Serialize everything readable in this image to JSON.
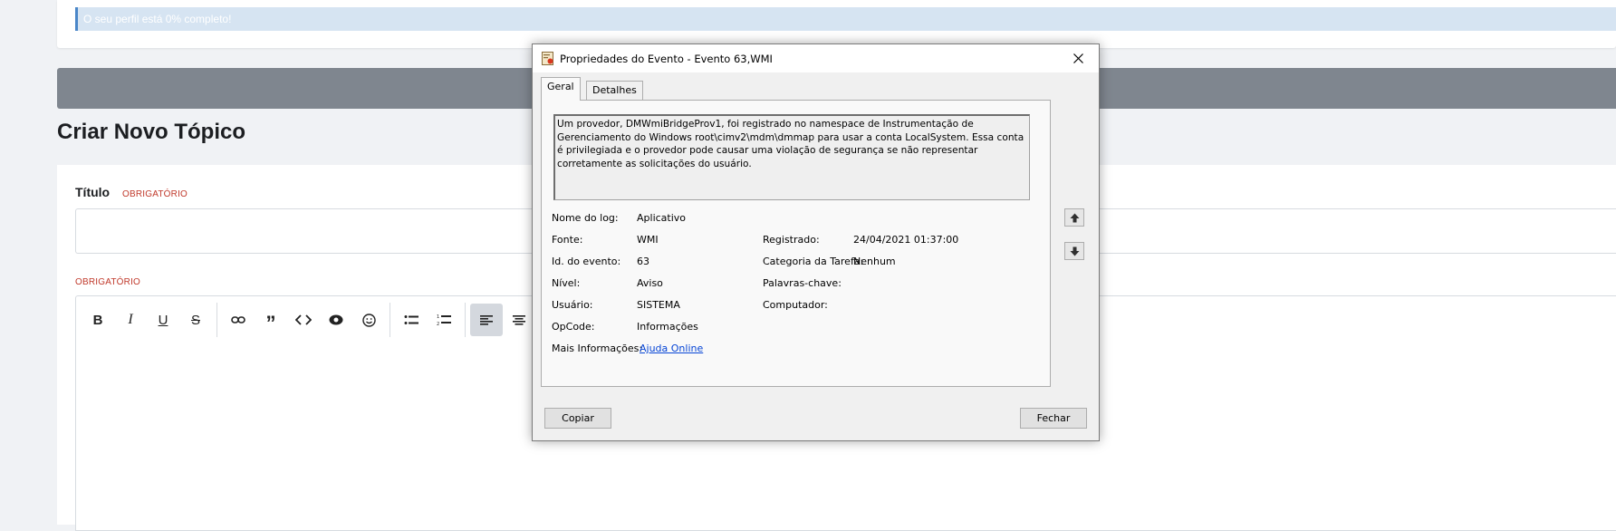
{
  "page": {
    "profile_progress": "O seu perfil está 0% completo!",
    "heading": "Criar Novo Tópico",
    "title_label": "Título",
    "required_tag": "OBRIGATÓRIO",
    "editor_required_tag": "OBRIGATÓRIO",
    "toolbar": [
      {
        "name": "bold-button",
        "glyph": "B"
      },
      {
        "name": "italic-button",
        "glyph": "I"
      },
      {
        "name": "underline-button",
        "glyph": "U"
      },
      {
        "name": "strikethrough-button",
        "glyph": "S"
      },
      {
        "name": "link-button",
        "glyph": "link-icon"
      },
      {
        "name": "quote-button",
        "glyph": "quote-icon"
      },
      {
        "name": "code-button",
        "glyph": "code-icon"
      },
      {
        "name": "spoiler-button",
        "glyph": "eye-icon"
      },
      {
        "name": "emoji-button",
        "glyph": "smile-icon"
      },
      {
        "name": "bullet-list-button",
        "glyph": "bullet-list-icon"
      },
      {
        "name": "numbered-list-button",
        "glyph": "numbered-list-icon"
      },
      {
        "name": "align-left-button",
        "glyph": "align-left-icon",
        "active": true
      },
      {
        "name": "align-center-button",
        "glyph": "align-center-icon"
      }
    ]
  },
  "dialog": {
    "title": "Propriedades do Evento - Evento 63,WMI",
    "tabs": [
      "Geral",
      "Detalhes"
    ],
    "active_tab": "Geral",
    "description": "Um provedor, DMWmiBridgeProv1, foi registrado no namespace de Instrumentação de Gerenciamento do Windows root\\cimv2\\mdm\\dmmap para usar a conta LocalSystem. Essa conta é privilegiada e o provedor pode causar uma violação de segurança se não representar corretamente as solicitações do usuário.",
    "fields": {
      "log_name_label": "Nome do log:",
      "log_name": "Aplicativo",
      "source_label": "Fonte:",
      "source": "WMI",
      "event_id_label": "Id. do evento:",
      "event_id": "63",
      "level_label": "Nível:",
      "level": "Aviso",
      "user_label": "Usuário:",
      "user": "SISTEMA",
      "opcode_label": "OpCode:",
      "opcode": "Informações",
      "more_info_label": "Mais Informações:",
      "more_info_link": "Ajuda Online",
      "logged_label": "Registrado:",
      "logged": "24/04/2021 01:37:00",
      "task_category_label": "Categoria da Tarefa:",
      "task_category": "Nenhum",
      "keywords_label": "Palavras-chave:",
      "keywords": "",
      "computer_label": "Computador:"
    },
    "copy_button": "Copiar",
    "close_button": "Fechar",
    "redaction_color": "#3a44d0"
  }
}
